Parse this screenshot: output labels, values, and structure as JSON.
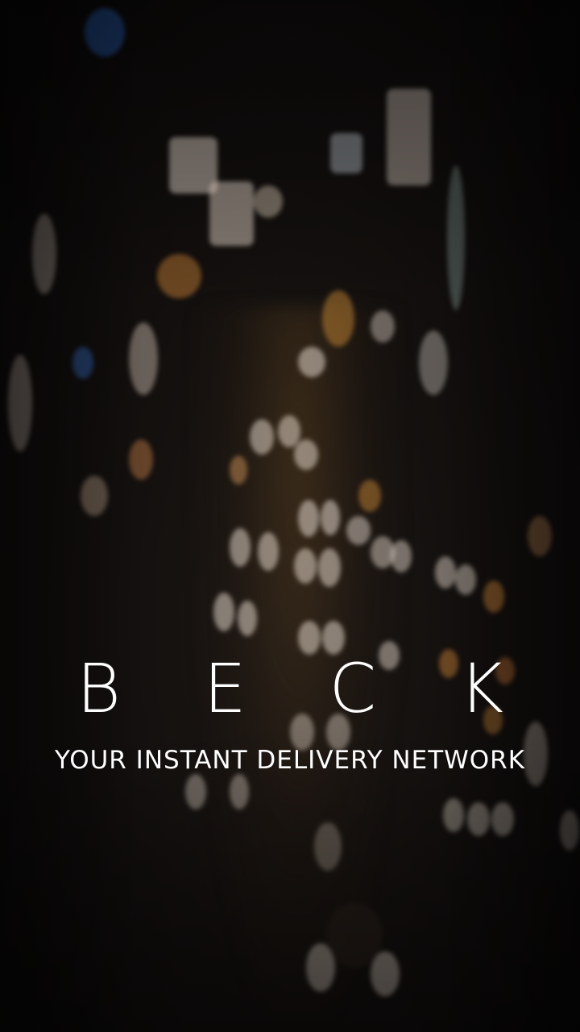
{
  "splash": {
    "brand_name": "B E C K",
    "tagline": "YOUR INSTANT DELIVERY NETWORK"
  },
  "background": {
    "description_icon": "city-night-bokeh-image",
    "base_color": "#0d0b0a",
    "light_colors": [
      "#f4e6da",
      "#d98c3a",
      "#2a6fd6",
      "#e0a060",
      "#cfd8e0"
    ]
  }
}
